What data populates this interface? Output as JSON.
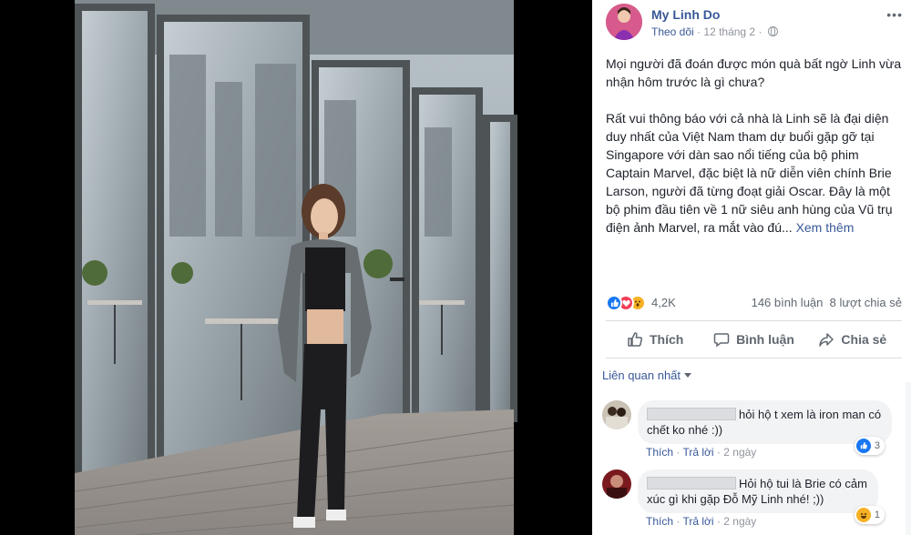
{
  "post": {
    "author": "My Linh Do",
    "follow": "Theo dõi",
    "sep": "·",
    "time": "12 tháng 2",
    "sep2": "·",
    "paragraph1": "Mọi người đã đoán được món quà bất ngờ Linh vừa nhận hôm trước là gì chưa?",
    "paragraph2": "Rất vui thông báo với cả nhà là Linh sẽ là đại diện duy nhất của Việt Nam tham dự buổi gặp gỡ tại Singapore với dàn sao nổi tiếng của bộ phim Captain Marvel, đặc biệt là nữ diễn viên chính Brie Larson, người đã từng đoạt giải Oscar. Đây là một bộ phim đầu tiên về 1 nữ siêu anh hùng của Vũ trụ điện ảnh Marvel, ra mắt vào đú...",
    "see_more": "Xem thêm"
  },
  "stats": {
    "reactions": "4,2K",
    "comments": "146 bình luận",
    "shares": "8 lượt chia sẻ"
  },
  "actions": {
    "like": "Thích",
    "comment": "Bình luận",
    "share": "Chia sẻ"
  },
  "sort_label": "Liên quan nhất",
  "comments": [
    {
      "line1": "hỏi hộ t xem là iron man có",
      "line2": "chết ko nhé :))",
      "like": "Thích",
      "reply": "Trả lời",
      "dot": "·",
      "time": "2 ngày",
      "reaction_icon": "like-icon",
      "reaction_count": "3"
    },
    {
      "line1": "Hỏi hộ tui là Brie có cảm",
      "line2": "xúc gì khi gặp Đỗ Mỹ Linh nhé! ;))",
      "like": "Thích",
      "reply": "Trả lời",
      "dot": "·",
      "time": "2 ngày",
      "reaction_icon": "haha-icon",
      "reaction_count": "1"
    }
  ],
  "colors": {
    "link": "#385898",
    "like_blue": "#1877f2",
    "love_red": "#f33e58",
    "wow_yellow": "#f7b125"
  }
}
